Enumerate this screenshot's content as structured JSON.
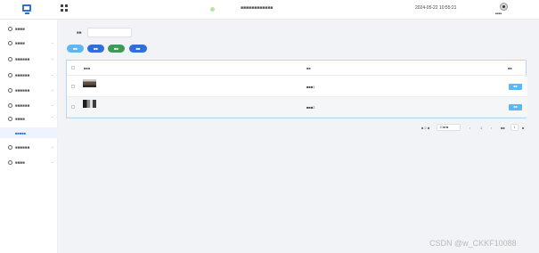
{
  "header": {
    "welcome": "■■■■■■■■■■■■",
    "datetime": "2024-05-22 10:55:21",
    "user_name": "■■■■"
  },
  "sidebar": {
    "items": [
      {
        "label": "■■■■"
      },
      {
        "label": "■■■■"
      },
      {
        "label": "■■■■■■"
      },
      {
        "label": "■■■■■■"
      },
      {
        "label": "■■■■■■"
      },
      {
        "label": "■■■■■■"
      },
      {
        "label": "■■■■"
      },
      {
        "label": "■■■■■■"
      },
      {
        "label": "■■■■"
      }
    ],
    "active_sub": "■■■■■"
  },
  "filter": {
    "label": "■■"
  },
  "toolbar": {
    "search": "■■",
    "add": "■■",
    "delete": "■■",
    "more": "■■"
  },
  "table": {
    "headers": {
      "image": "■■■",
      "title": "■■",
      "operation": "■■"
    },
    "rows": [
      {
        "title": "■■■1",
        "detail": "■■"
      },
      {
        "title": "■■■2",
        "detail": "■■"
      }
    ]
  },
  "pagination": {
    "total": "■ 2 ■",
    "page_size": "10■/■",
    "current": "1",
    "goto_label": "■■",
    "jump_value": "1",
    "page_suffix": "■"
  },
  "watermark": "CSDN @w_CKKF10088",
  "colors": {
    "accent": "#2f6fdb",
    "light_accent": "#5fb7f2",
    "success": "#3c9c55"
  }
}
